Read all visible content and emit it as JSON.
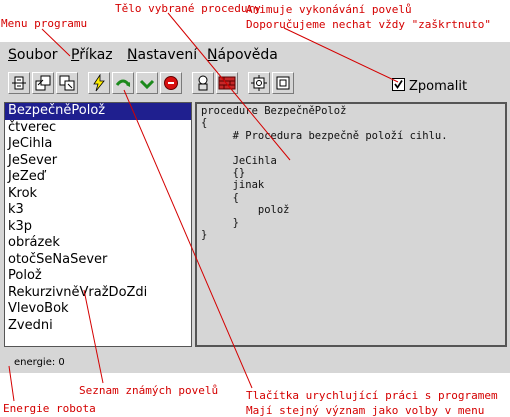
{
  "annotations": {
    "menu": "Menu programu",
    "body": "Tělo vybrané procedury",
    "anim1": "Animuje vykonávání povelů",
    "anim2": "Doporučujeme nechat vždy \"zaškrtnuto\"",
    "list": "Seznam známých povelů",
    "buttons1": "Tlačítka urychlující práci s programem",
    "buttons2": "Mají stejný význam jako volby v menu",
    "energy": "Energie robota"
  },
  "menu": {
    "soubor": {
      "ul": "S",
      "rest": "oubor"
    },
    "prikaz": {
      "ul": "P",
      "rest": "říkaz"
    },
    "nastaveni": {
      "ul": "N",
      "rest": "astavení"
    },
    "napoveda": {
      "ul": "N",
      "rest": "ápověda"
    }
  },
  "toolbar": {
    "icons": [
      "new-procedure-icon",
      "open-icon",
      "save-icon",
      "lightning-icon",
      "step-over-icon",
      "step-into-icon",
      "stop-icon",
      "robot-icon",
      "wall-icon",
      "settings-icon",
      "frame-icon"
    ],
    "slow_label": "Zpomalit",
    "slow_checked": true
  },
  "commands": [
    "BezpečněPolož",
    "čtverec",
    "JeCihla",
    "JeSever",
    "JeZeď",
    "Krok",
    "k3",
    "k3p",
    "obrázek",
    "otočSeNaSever",
    "Polož",
    "RekurzivněVražDoZdi",
    "VlevoBok",
    "Zvedni"
  ],
  "selected_command": "BezpečněPolož",
  "code": "procedure BezpečněPolož\n{\n     # Procedura bezpečně položí cihlu.\n\n     JeCihla\n     {}\n     jinak\n     {\n         polož\n     }\n}",
  "status": "energie: 0",
  "colors": {
    "annotation": "#d40000",
    "selection": "#1f1f8f",
    "window": "#d6d6d6"
  }
}
